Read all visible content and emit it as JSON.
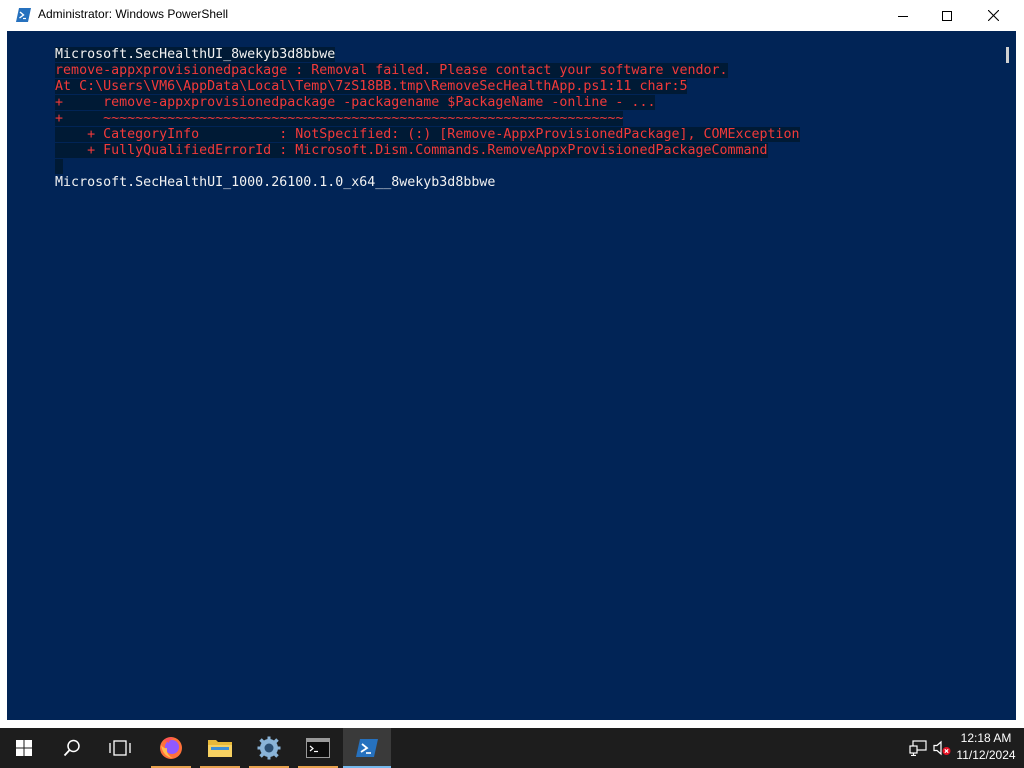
{
  "window": {
    "title": "Administrator: Windows PowerShell"
  },
  "console": {
    "lines": [
      {
        "text": "Microsoft.SecHealthUI_8wekyb3d8bbwe",
        "color": "#f2f2f2"
      },
      {
        "text": "remove-appxprovisionedpackage : Removal failed. Please contact your software vendor.",
        "color": "#f23a3a"
      },
      {
        "text": "At C:\\Users\\VM6\\AppData\\Local\\Temp\\7zS18BB.tmp\\RemoveSecHealthApp.ps1:11 char:5",
        "color": "#f23a3a"
      },
      {
        "text": "+     remove-appxprovisionedpackage -packagename $PackageName -online - ...",
        "color": "#f23a3a"
      },
      {
        "text": "+     ~~~~~~~~~~~~~~~~~~~~~~~~~~~~~~~~~~~~~~~~~~~~~~~~~~~~~~~~~~~~~~~~~",
        "color": "#f23a3a"
      },
      {
        "text": "    + CategoryInfo          : NotSpecified: (:) [Remove-AppxProvisionedPackage], COMException",
        "color": "#f23a3a"
      },
      {
        "text": "    + FullyQualifiedErrorId : Microsoft.Dism.Commands.RemoveAppxProvisionedPackageCommand",
        "color": "#f23a3a"
      },
      {
        "text": " ",
        "color": "#f2f2f2"
      },
      {
        "text": "Microsoft.SecHealthUI_1000.26100.1.0_x64__8wekyb3d8bbwe",
        "color": "#f2f2f2"
      }
    ]
  },
  "taskbar": {
    "items": [
      {
        "name": "start-button",
        "icon": "windows-logo-icon"
      },
      {
        "name": "search-button",
        "icon": "search-icon"
      },
      {
        "name": "task-view-button",
        "icon": "task-view-icon"
      },
      {
        "name": "firefox-button",
        "icon": "firefox-icon"
      },
      {
        "name": "file-explorer-button",
        "icon": "folder-icon"
      },
      {
        "name": "settings-button",
        "icon": "gear-icon"
      },
      {
        "name": "command-prompt-button",
        "icon": "cmd-icon"
      },
      {
        "name": "powershell-button",
        "icon": "powershell-icon"
      }
    ],
    "clock": {
      "time": "12:18 AM",
      "date": "11/12/2024"
    }
  },
  "colors": {
    "console_bg": "#012456",
    "error_text": "#f23a3a",
    "normal_text": "#f2f2f2",
    "taskbar_bg": "#1d1d1d"
  }
}
